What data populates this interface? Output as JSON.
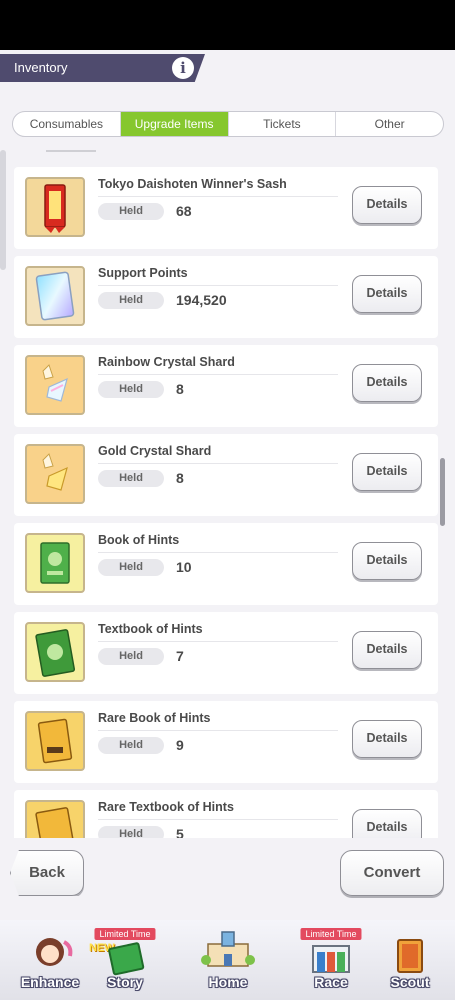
{
  "header": {
    "title": "Inventory",
    "info_icon": "i"
  },
  "tabs": [
    {
      "label": "Consumables",
      "active": false
    },
    {
      "label": "Upgrade Items",
      "active": true
    },
    {
      "label": "Tickets",
      "active": false
    },
    {
      "label": "Other",
      "active": false
    }
  ],
  "items": [
    {
      "name": "Tokyo Daishoten Winner's Sash",
      "held_label": "Held",
      "held": "68",
      "details_label": "Details",
      "icon": "sash-icon"
    },
    {
      "name": "Support Points",
      "held_label": "Held",
      "held": "194,520",
      "details_label": "Details",
      "icon": "support-points-card-icon"
    },
    {
      "name": "Rainbow Crystal Shard",
      "held_label": "Held",
      "held": "8",
      "details_label": "Details",
      "icon": "rainbow-crystal-icon"
    },
    {
      "name": "Gold Crystal Shard",
      "held_label": "Held",
      "held": "8",
      "details_label": "Details",
      "icon": "gold-crystal-icon"
    },
    {
      "name": "Book of Hints",
      "held_label": "Held",
      "held": "10",
      "details_label": "Details",
      "icon": "green-book-icon"
    },
    {
      "name": "Textbook of Hints",
      "held_label": "Held",
      "held": "7",
      "details_label": "Details",
      "icon": "green-textbook-icon"
    },
    {
      "name": "Rare Book of Hints",
      "held_label": "Held",
      "held": "9",
      "details_label": "Details",
      "icon": "rare-book-icon"
    },
    {
      "name": "Rare Textbook of Hints",
      "held_label": "Held",
      "held": "5",
      "details_label": "Details",
      "icon": "rare-textbook-icon"
    }
  ],
  "actions": {
    "back_label": "Back",
    "convert_label": "Convert"
  },
  "bottom_nav": [
    {
      "label": "Enhance",
      "icon": "horse-girl-icon"
    },
    {
      "label": "Story",
      "icon": "story-book-icon",
      "badge": "Limited Time",
      "new": "NEW"
    },
    {
      "label": "Home",
      "icon": "school-building-icon"
    },
    {
      "label": "Race",
      "icon": "race-gate-icon",
      "badge": "Limited Time"
    },
    {
      "label": "Scout",
      "icon": "scout-card-icon"
    }
  ],
  "colors": {
    "accent_green": "#86c72e",
    "header_bg": "#4f4b6e",
    "limited_badge": "#e34a5f"
  }
}
